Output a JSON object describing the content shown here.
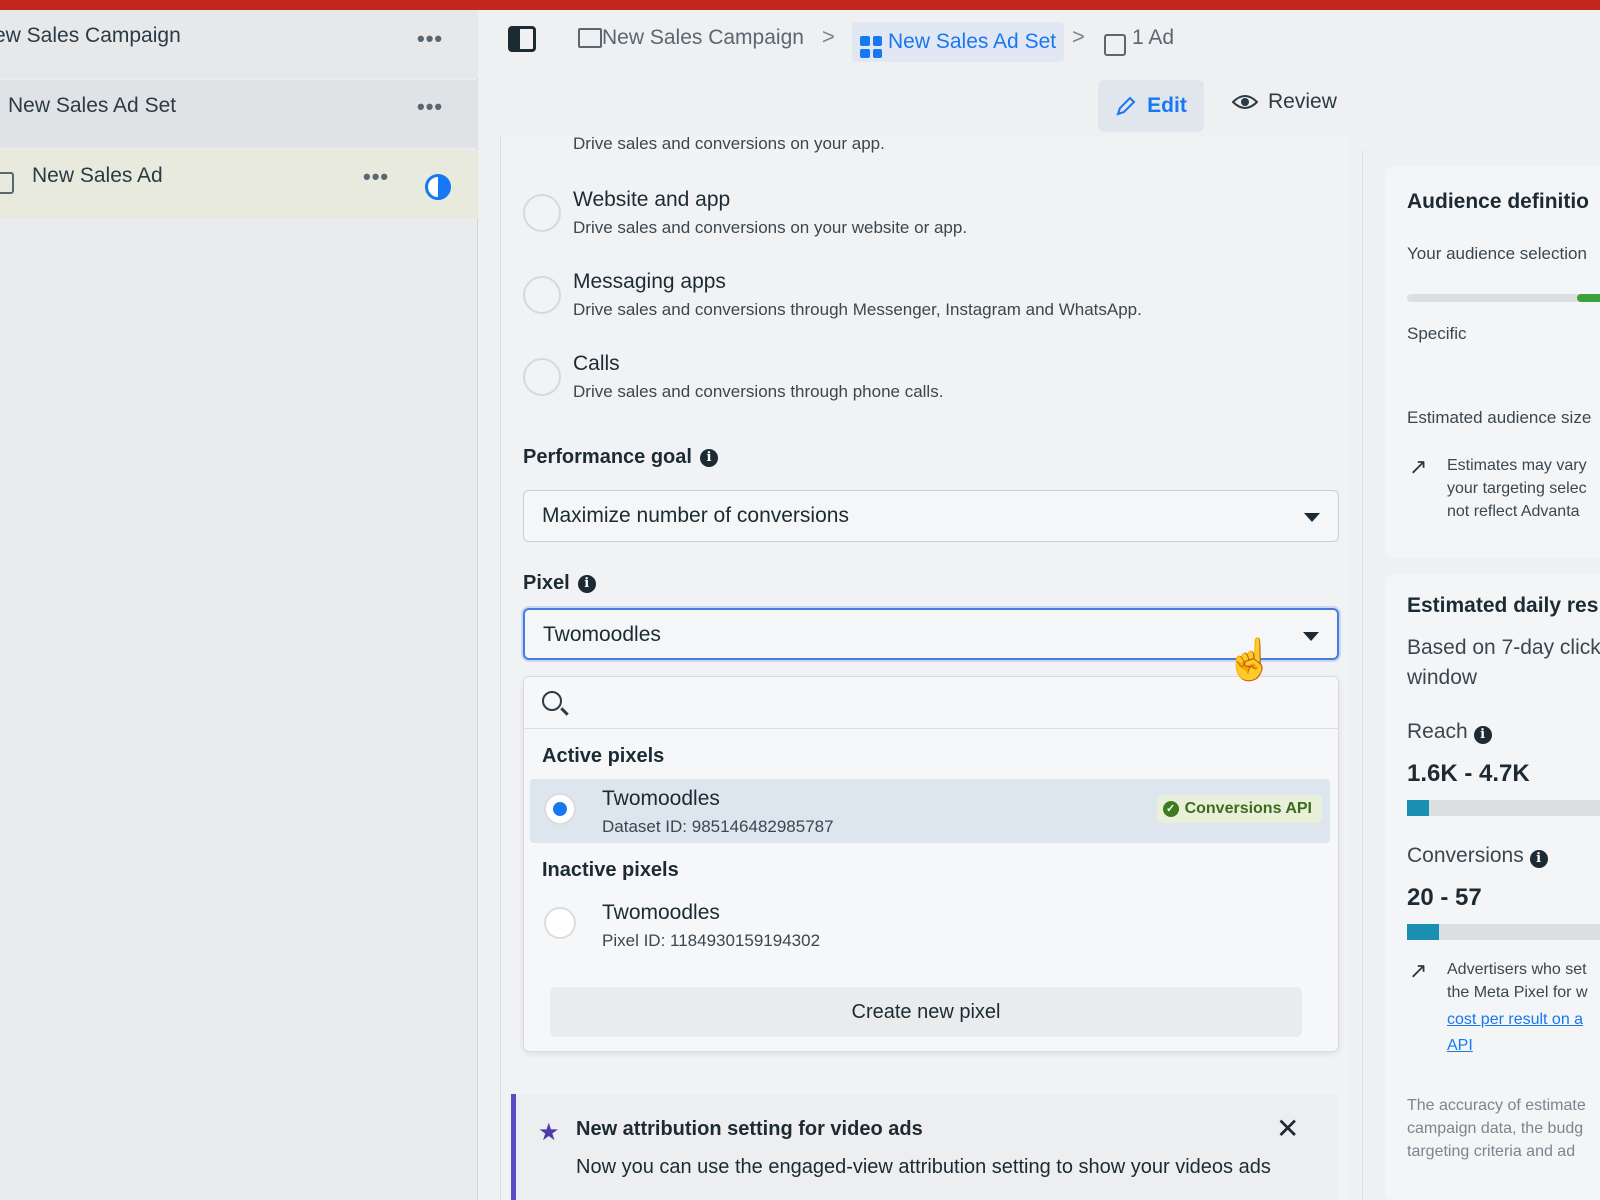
{
  "sidebar": {
    "campaign_label": "ew Sales Campaign",
    "adset_label": "New Sales Ad Set",
    "ad_label": "New Sales Ad",
    "more_label": "•••"
  },
  "breadcrumb": {
    "campaign": "New Sales Campaign",
    "adset": "New Sales Ad Set",
    "ad": "1 Ad",
    "separator": ">"
  },
  "mode": {
    "edit": "Edit",
    "review": "Review"
  },
  "options": [
    {
      "title": "",
      "desc": "Drive sales and conversions on your app."
    },
    {
      "title": "Website and app",
      "desc": "Drive sales and conversions on your website or app."
    },
    {
      "title": "Messaging apps",
      "desc": "Drive sales and conversions through Messenger, Instagram and WhatsApp."
    },
    {
      "title": "Calls",
      "desc": "Drive sales and conversions through phone calls."
    }
  ],
  "performance_goal": {
    "label": "Performance goal",
    "value": "Maximize number of conversions"
  },
  "pixel": {
    "label": "Pixel",
    "value": "Twomoodles",
    "active_label": "Active pixels",
    "inactive_label": "Inactive pixels",
    "active": {
      "name": "Twomoodles",
      "id": "Dataset ID: 985146482985787",
      "badge": "Conversions API"
    },
    "inactive": {
      "name": "Twomoodles",
      "id": "Pixel ID: 1184930159194302"
    },
    "create_label": "Create new pixel"
  },
  "notice": {
    "title": "New attribution setting for video ads",
    "text": "Now you can use the engaged-view attribution setting to show your videos ads",
    "close": "✕"
  },
  "audience": {
    "title": "Audience definitio",
    "selection": "Your audience selection",
    "specific": "Specific",
    "size_label": "Estimated audience size",
    "note_lines": [
      "Estimates may vary",
      "your targeting selec",
      "not reflect Advanta"
    ]
  },
  "results": {
    "title": "Estimated daily res",
    "basis_line1": "Based on 7-day click",
    "basis_line2": "window",
    "reach_label": "Reach",
    "reach_value": "1.6K - 4.7K",
    "conversions_label": "Conversions",
    "conversions_value": "20 - 57",
    "advert_lines": [
      "Advertisers who set",
      "the Meta Pixel for w"
    ],
    "advert_link": "cost per result on a",
    "advert_link2": "API",
    "accuracy_lines": [
      "The accuracy of estimate",
      "campaign data, the budg",
      "targeting criteria and ad"
    ]
  },
  "colors": {
    "accent": "#1877f2",
    "brand_red": "#c4261d",
    "success": "#3d7a20",
    "notice": "#5b4bc4"
  }
}
